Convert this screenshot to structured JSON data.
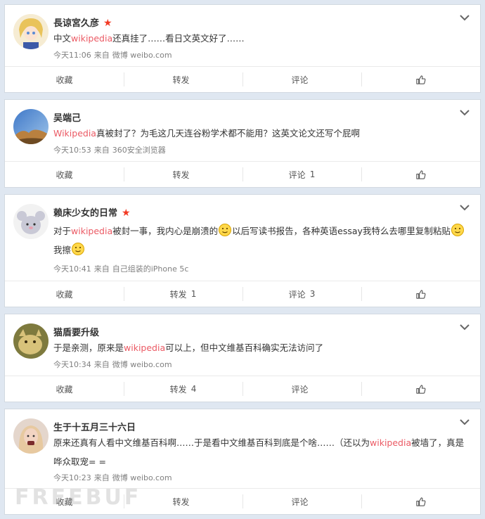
{
  "icons": {
    "menu": "chevron-down-icon",
    "like": "thumbs-up-icon",
    "vip": "star-icon",
    "emoji": "smile-emoji-icon"
  },
  "colors": {
    "highlight": "#eb5a64",
    "star": "#f23a24",
    "background": "#dfe7f1"
  },
  "actions": {
    "favorite": "收藏",
    "repost": "转发",
    "comment": "评论"
  },
  "posts": [
    {
      "user": "長谅宮久彦",
      "vip": true,
      "text": {
        "a": "中文",
        "b": "wikipedia",
        "c": "还真挂了……看日文英文好了……"
      },
      "time": "今天11:06",
      "from": "来自",
      "source": "微博 weibo.com",
      "repost_count": "",
      "comment_count": ""
    },
    {
      "user": "吴端己",
      "vip": false,
      "text": {
        "a": "",
        "b": "Wikipedia",
        "c": "真被封了？为毛这几天连谷粉学术都不能用？这英文论文还写个屁啊"
      },
      "time": "今天10:53",
      "from": "来自",
      "source": "360安全浏览器",
      "repost_count": "",
      "comment_count": "1"
    },
    {
      "user": "赖床少女的日常",
      "vip": true,
      "text": {
        "a": "对于",
        "b": "wikipedia",
        "c": "被封一事，我内心是崩溃的",
        "d": "以后写读书报告，各种英语essay我特么去哪里复制粘贴",
        "e": "我擦"
      },
      "time": "今天10:41",
      "from": "来自",
      "source": "自己组装的iPhone 5c",
      "repost_count": "1",
      "comment_count": "3"
    },
    {
      "user": "猫盾要升级",
      "vip": false,
      "text": {
        "a": "于是亲测，原来是",
        "b": "wikipedia",
        "c": "可以上，但中文维基百科确实无法访问了"
      },
      "time": "今天10:34",
      "from": "来自",
      "source": "微博 weibo.com",
      "repost_count": "4",
      "comment_count": ""
    },
    {
      "user": "生于十五月三十六日",
      "vip": false,
      "text": {
        "a": "原来还真有人看中文维基百科啊……于是看中文维基百科到底是个啥……（还以为",
        "b": "wikipedia",
        "c": "被墙了，真是哗众取宠= ="
      },
      "time": "今天10:23",
      "from": "来自",
      "source": "微博 weibo.com",
      "repost_count": "",
      "comment_count": ""
    }
  ],
  "watermark": "FREEBUF"
}
